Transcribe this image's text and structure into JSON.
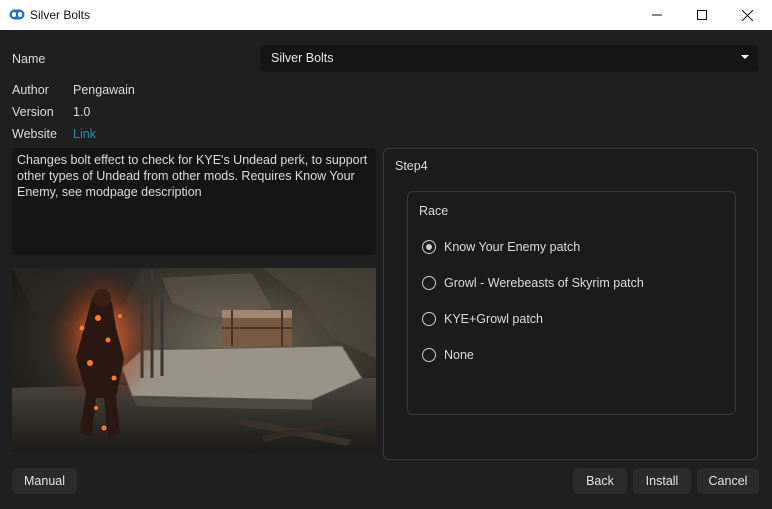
{
  "window": {
    "title": "Silver Bolts"
  },
  "info": {
    "name_label": "Name",
    "name_value": "Silver Bolts",
    "author_label": "Author",
    "author_value": "Pengawain",
    "version_label": "Version",
    "version_value": "1.0",
    "website_label": "Website",
    "website_value": "Link",
    "description": "Changes bolt effect to check for KYE's Undead perk, to support other types of Undead from other mods. Requires Know Your Enemy, see modpage description"
  },
  "step": {
    "title": "Step4",
    "group_title": "Race",
    "options": [
      {
        "label": "Know Your Enemy patch",
        "selected": true
      },
      {
        "label": "Growl - Werebeasts of Skyrim patch",
        "selected": false
      },
      {
        "label": "KYE+Growl patch",
        "selected": false
      },
      {
        "label": "None",
        "selected": false
      }
    ]
  },
  "buttons": {
    "manual": "Manual",
    "back": "Back",
    "install": "Install",
    "cancel": "Cancel"
  },
  "colors": {
    "background": "#1f1f1f",
    "input_bg": "#151515",
    "link": "#2a8fa6",
    "app_icon": "#1e73c8"
  },
  "icons": [
    "app-icon",
    "minimize-icon",
    "maximize-icon",
    "close-icon",
    "chevron-down-icon"
  ]
}
